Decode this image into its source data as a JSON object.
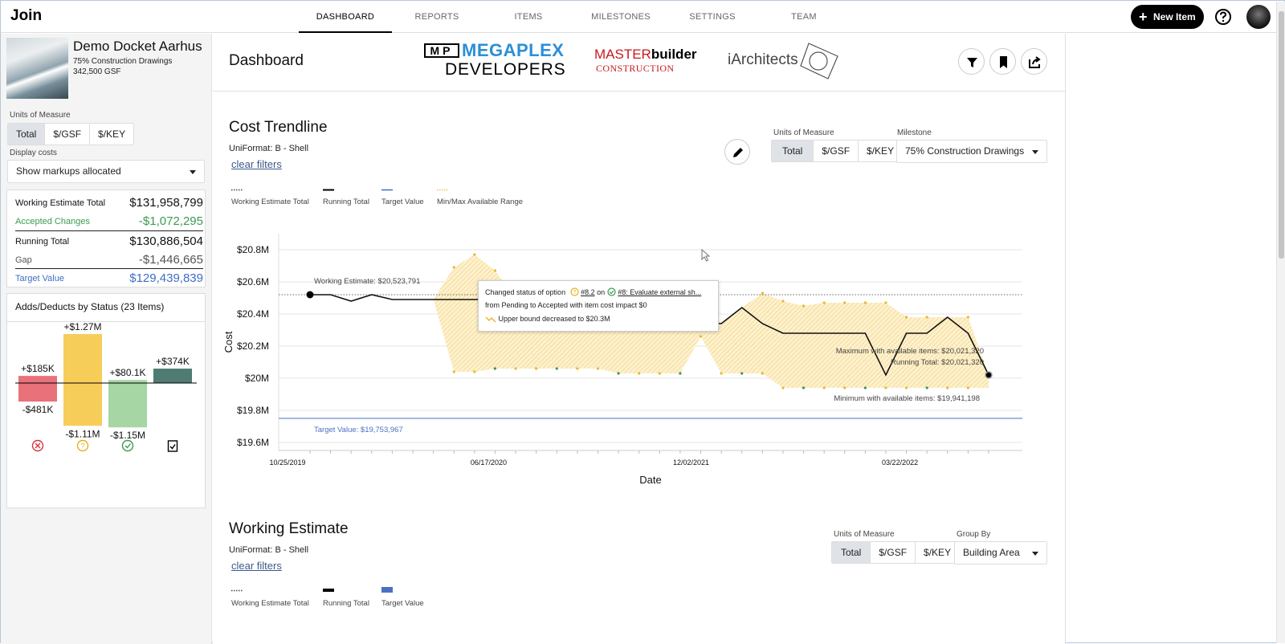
{
  "app": {
    "name": "Join"
  },
  "nav": {
    "tabs": [
      "DASHBOARD",
      "REPORTS",
      "ITEMS",
      "MILESTONES",
      "SETTINGS",
      "TEAM"
    ],
    "active": "DASHBOARD",
    "new_item": "New Item"
  },
  "project": {
    "name": "Demo Docket Aarhus",
    "milestone": "75% Construction Drawings",
    "area": "342,500 GSF"
  },
  "sidebar": {
    "units_label": "Units of Measure",
    "units": [
      "Total",
      "$/GSF",
      "$/KEY"
    ],
    "units_selected": "Total",
    "display_costs_label": "Display costs",
    "display_costs_value": "Show markups allocated",
    "summary": [
      {
        "label": "Working Estimate Total",
        "value": "$131,958,799"
      },
      {
        "label": "Accepted Changes",
        "value": "-$1,072,295"
      },
      {
        "label": "Running Total",
        "value": "$130,886,504"
      },
      {
        "label": "Gap",
        "value": "-$1,446,665"
      },
      {
        "label": "Target Value",
        "value": "$129,439,839"
      }
    ],
    "status_title": "Adds/Deducts by Status (23 Items)",
    "status_bars": [
      {
        "status": "rejected",
        "add": "+$185K",
        "deduct": "-$481K",
        "add_value": 185,
        "deduct_value": -481,
        "color": "#e8717a"
      },
      {
        "status": "pending",
        "add": "+$1.27M",
        "deduct": "-$1.11M",
        "add_value": 1270,
        "deduct_value": -1110,
        "color": "#f7cd5a"
      },
      {
        "status": "accepted",
        "add": "+$80.1K",
        "deduct": "-$1.15M",
        "add_value": 80.1,
        "deduct_value": -1150,
        "color": "#a5d6a4"
      },
      {
        "status": "incorporated",
        "add": "+$374K",
        "deduct": "",
        "add_value": 374,
        "deduct_value": 0,
        "color": "#4e7b72"
      }
    ],
    "status_icons": [
      "x-circle-icon",
      "question-circle-icon",
      "check-circle-icon",
      "clipboard-check-icon"
    ]
  },
  "dashboard": {
    "title": "Dashboard",
    "logos": {
      "megaplex_top": "MEGAPLEX",
      "megaplex_bottom": "DEVELOPERS",
      "megaplex_mark": "MP",
      "master_a": "MASTER",
      "master_b": "builder",
      "master_c": "CONSTRUCTION",
      "iarch": "iArchitects"
    },
    "actions": [
      "filter-icon",
      "bookmark-icon",
      "share-icon"
    ]
  },
  "trendline": {
    "title": "Cost Trendline",
    "subtitle": "UniFormat: B - Shell",
    "clear_filters": "clear filters",
    "units_label": "Units of Measure",
    "units": [
      "Total",
      "$/GSF",
      "$/KEY"
    ],
    "units_selected": "Total",
    "milestone_label": "Milestone",
    "milestone_value": "75% Construction Drawings",
    "legend": [
      "Working Estimate Total",
      "Running Total",
      "Target Value",
      "Min/Max Available Range"
    ],
    "tooltip": {
      "l1a": "Changed status of option",
      "l1b": "#8.2",
      "l1c": "on",
      "l1d": "#8: Evaluate external sh...",
      "l2": "from Pending to Accepted with item cost impact $0",
      "l3": "Upper bound decreased to $20.3M"
    }
  },
  "chart_data": {
    "type": "line",
    "xlabel": "Date",
    "ylabel": "Cost",
    "x_ticks": [
      "10/25/2019",
      "06/17/2020",
      "12/02/2021",
      "03/22/2022"
    ],
    "y_ticks": [
      "$20.8M",
      "$20.6M",
      "$20.4M",
      "$20.2M",
      "$20M",
      "$19.8M",
      "$19.6M"
    ],
    "ylim": [
      19.55,
      20.9
    ],
    "series": [
      {
        "name": "Running Total",
        "values": [
          20.52,
          20.52,
          20.48,
          20.52,
          20.49,
          20.49,
          20.49,
          20.49,
          20.49,
          20.49,
          20.49,
          20.49,
          20.49,
          20.49,
          20.49,
          20.49,
          20.49,
          20.49,
          20.34,
          20.34,
          20.34,
          20.44,
          20.34,
          20.28,
          20.28,
          20.28,
          20.28,
          20.28,
          20.02,
          20.28,
          20.28,
          20.38,
          20.28,
          20.02
        ]
      },
      {
        "name": "Min/Max Available Range upper",
        "values": [
          20.52,
          20.52,
          20.48,
          20.52,
          20.49,
          20.49,
          20.49,
          20.69,
          20.77,
          20.67,
          20.49,
          20.49,
          20.49,
          20.49,
          20.49,
          20.49,
          20.49,
          20.49,
          20.34,
          20.53,
          20.34,
          20.44,
          20.53,
          20.48,
          20.45,
          20.47,
          20.47,
          20.47,
          20.47,
          20.38,
          20.38,
          20.38,
          20.38,
          20.02
        ]
      },
      {
        "name": "Min/Max Available Range lower",
        "values": [
          20.52,
          20.52,
          20.48,
          20.52,
          20.49,
          20.49,
          20.49,
          20.04,
          20.04,
          20.06,
          20.06,
          20.06,
          20.06,
          20.06,
          20.06,
          20.03,
          20.03,
          20.03,
          20.03,
          20.26,
          20.03,
          20.03,
          20.03,
          19.94,
          19.94,
          19.94,
          19.94,
          19.94,
          19.94,
          19.94,
          19.94,
          19.94,
          19.94,
          19.94
        ]
      }
    ],
    "annotations": {
      "working_estimate": "Working Estimate: $20,523,791",
      "max": "Maximum with available items: $20,021,320",
      "running": "Running Total: $20,021,320",
      "min": "Minimum with available items: $19,941,198",
      "target": "Target Value: $19,753,967"
    },
    "working_estimate_value": 20.52,
    "target_value": 19.75
  },
  "working_estimate": {
    "title": "Working Estimate",
    "subtitle": "UniFormat: B - Shell",
    "clear_filters": "clear filters",
    "units_label": "Units of Measure",
    "units": [
      "Total",
      "$/GSF",
      "$/KEY"
    ],
    "units_selected": "Total",
    "group_label": "Group By",
    "group_value": "Building Area",
    "legend": [
      "Working Estimate Total",
      "Running Total",
      "Target Value"
    ]
  }
}
